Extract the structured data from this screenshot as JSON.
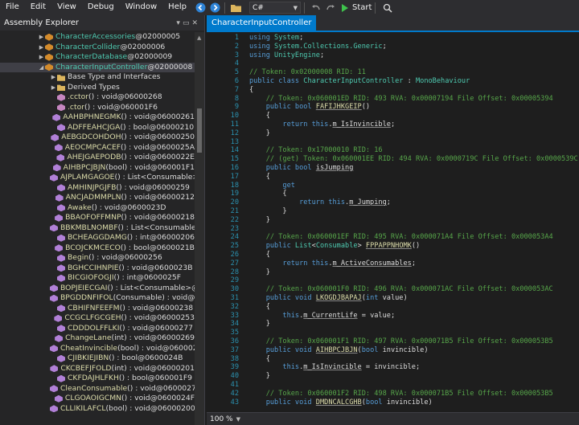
{
  "menu": {
    "items": [
      "File",
      "Edit",
      "View",
      "Debug",
      "Window",
      "Help"
    ],
    "language": "C#",
    "start_label": "Start"
  },
  "explorer": {
    "title": "Assembly Explorer",
    "rows": [
      {
        "expander": "▶",
        "icon": "class",
        "name": "CharacterAccessories",
        "nameKind": "class",
        "suffix": " @02000005",
        "indent": 1
      },
      {
        "expander": "▶",
        "icon": "class",
        "name": "CharacterCollider",
        "nameKind": "class",
        "suffix": " @02000006",
        "indent": 1
      },
      {
        "expander": "▶",
        "icon": "class",
        "name": "CharacterDatabase",
        "nameKind": "class",
        "suffix": " @02000009",
        "indent": 1
      },
      {
        "expander": "◢",
        "icon": "class",
        "name": "CharacterInputController",
        "nameKind": "class",
        "suffix": " @02000008",
        "indent": 1,
        "selected": true
      },
      {
        "expander": "▶",
        "icon": "folder",
        "name": "Base Type and Interfaces",
        "nameKind": "plain",
        "suffix": "",
        "indent": 2
      },
      {
        "expander": "▶",
        "icon": "folder",
        "name": "Derived Types",
        "nameKind": "plain",
        "suffix": "",
        "indent": 2
      },
      {
        "expander": "",
        "icon": "ctor",
        "name": ".cctor",
        "nameKind": "method",
        "sig": "() : void",
        "suffix": " @06000268",
        "indent": 2
      },
      {
        "expander": "",
        "icon": "ctor",
        "name": ".ctor",
        "nameKind": "method",
        "sig": "() : void",
        "suffix": " @060001F6",
        "indent": 2
      },
      {
        "expander": "",
        "icon": "method",
        "name": "AAHBPHNEGMK",
        "nameKind": "method",
        "sig": "() : void",
        "suffix": " @06000261",
        "indent": 2
      },
      {
        "expander": "",
        "icon": "method",
        "name": "ADFFEAHCJGA",
        "nameKind": "method",
        "sig": "() : bool",
        "suffix": " @06000210",
        "indent": 2
      },
      {
        "expander": "",
        "icon": "method",
        "name": "AEBGDCOHDOH",
        "nameKind": "method",
        "sig": "() : void",
        "suffix": " @06000250",
        "indent": 2
      },
      {
        "expander": "",
        "icon": "method",
        "name": "AEOCMPCACEF",
        "nameKind": "method",
        "sig": "() : void",
        "suffix": " @0600025A",
        "indent": 2
      },
      {
        "expander": "",
        "icon": "method",
        "name": "AHEJGAEPODB",
        "nameKind": "method",
        "sig": "() : void",
        "suffix": " @0600022E",
        "indent": 2
      },
      {
        "expander": "",
        "icon": "method",
        "name": "AIHBPCJBJN",
        "nameKind": "method",
        "sig": "(bool) : void",
        "suffix": " @060001F1",
        "indent": 2
      },
      {
        "expander": "",
        "icon": "method",
        "name": "AJPLAMGAGOE",
        "nameKind": "method",
        "sig": "() : List<Consumable>",
        "suffix": "",
        "indent": 2
      },
      {
        "expander": "",
        "icon": "method",
        "name": "AMHINJPGJFB",
        "nameKind": "method",
        "sig": "() : void",
        "suffix": " @06000259",
        "indent": 2
      },
      {
        "expander": "",
        "icon": "method",
        "name": "ANCJADMMPLN",
        "nameKind": "method",
        "sig": "() : void",
        "suffix": " @06000212",
        "indent": 2
      },
      {
        "expander": "",
        "icon": "method",
        "name": "Awake",
        "nameKind": "method",
        "sig": "() : void",
        "suffix": " @0600023D",
        "indent": 2
      },
      {
        "expander": "",
        "icon": "method",
        "name": "BBAOFOFFMNP",
        "nameKind": "method",
        "sig": "() : void",
        "suffix": " @06000218",
        "indent": 2
      },
      {
        "expander": "",
        "icon": "method",
        "name": "BBKMBLNOMBF",
        "nameKind": "method",
        "sig": "() : List<Consumable>",
        "suffix": "",
        "indent": 2
      },
      {
        "expander": "",
        "icon": "method",
        "name": "BCHEAGGDAMG",
        "nameKind": "method",
        "sig": "() : int",
        "suffix": " @06000206",
        "indent": 2
      },
      {
        "expander": "",
        "icon": "method",
        "name": "BCOJCKMCECO",
        "nameKind": "method",
        "sig": "() : bool",
        "suffix": " @0600021B",
        "indent": 2
      },
      {
        "expander": "",
        "icon": "method",
        "name": "Begin",
        "nameKind": "method",
        "sig": "() : void",
        "suffix": " @06000256",
        "indent": 2
      },
      {
        "expander": "",
        "icon": "method",
        "name": "BGHCCIHNPIE",
        "nameKind": "method",
        "sig": "() : void",
        "suffix": " @0600023B",
        "indent": 2
      },
      {
        "expander": "",
        "icon": "method",
        "name": "BICGIOFOGJI",
        "nameKind": "method",
        "sig": "() : int",
        "suffix": " @0600025F",
        "indent": 2
      },
      {
        "expander": "",
        "icon": "method",
        "name": "BOPJEIECGAI",
        "nameKind": "method",
        "sig": "() : List<Consumable>",
        "suffix": " @",
        "indent": 2
      },
      {
        "expander": "",
        "icon": "method",
        "name": "BPGDDNFIFOL",
        "nameKind": "method",
        "sig": "(Consumable) : void",
        "suffix": " @0600",
        "indent": 2
      },
      {
        "expander": "",
        "icon": "method",
        "name": "CBHIFNFEEFM",
        "nameKind": "method",
        "sig": "() : void",
        "suffix": " @06000238",
        "indent": 2
      },
      {
        "expander": "",
        "icon": "method",
        "name": "CCGCLFGCGEH",
        "nameKind": "method",
        "sig": "() : void",
        "suffix": " @06000253",
        "indent": 2
      },
      {
        "expander": "",
        "icon": "method",
        "name": "CDDDOLFFLKI",
        "nameKind": "method",
        "sig": "() : void",
        "suffix": " @06000277",
        "indent": 2
      },
      {
        "expander": "",
        "icon": "method",
        "name": "ChangeLane",
        "nameKind": "method",
        "sig": "(int) : void",
        "suffix": " @06000269",
        "indent": 2
      },
      {
        "expander": "",
        "icon": "method",
        "name": "CheatInvincible",
        "nameKind": "method",
        "sig": "(bool) : void",
        "suffix": " @060002",
        "indent": 2
      },
      {
        "expander": "",
        "icon": "method",
        "name": "CJIBKIEJIBN",
        "nameKind": "method",
        "sig": "() : bool",
        "suffix": " @0600024B",
        "indent": 2
      },
      {
        "expander": "",
        "icon": "method",
        "name": "CKCBEFJFOLD",
        "nameKind": "method",
        "sig": "(int) : void",
        "suffix": " @06000201",
        "indent": 2
      },
      {
        "expander": "",
        "icon": "method",
        "name": "CKFDAJHLFKH",
        "nameKind": "method",
        "sig": "() : bool",
        "suffix": " @060001F9",
        "indent": 2
      },
      {
        "expander": "",
        "icon": "method",
        "name": "CleanConsumable",
        "nameKind": "method",
        "sig": "() : void",
        "suffix": " @06000279",
        "indent": 2
      },
      {
        "expander": "",
        "icon": "method",
        "name": "CLGOAOIGCMN",
        "nameKind": "method",
        "sig": "() : void",
        "suffix": " @0600024F",
        "indent": 2
      },
      {
        "expander": "",
        "icon": "method",
        "name": "CLLIKILAFCL",
        "nameKind": "method",
        "sig": "(bool) : void",
        "suffix": " @06000200",
        "indent": 2
      }
    ]
  },
  "editor": {
    "tab_label": "CharacterInputController",
    "zoom": "100 %",
    "lines": [
      {
        "n": "1",
        "fold": "",
        "parts": [
          [
            "kw",
            "using "
          ],
          [
            "type",
            "System"
          ],
          [
            "txt",
            ";"
          ]
        ]
      },
      {
        "n": "2",
        "fold": "",
        "parts": [
          [
            "kw",
            "using "
          ],
          [
            "type",
            "System.Collections.Generic"
          ],
          [
            "txt",
            ";"
          ]
        ]
      },
      {
        "n": "3",
        "fold": "",
        "parts": [
          [
            "kw",
            "using "
          ],
          [
            "type",
            "UnityEngine"
          ],
          [
            "txt",
            ";"
          ]
        ]
      },
      {
        "n": "4",
        "fold": "",
        "parts": []
      },
      {
        "n": "5",
        "fold": "",
        "parts": [
          [
            "cmt",
            "// Token: 0x02000008 RID: 11"
          ]
        ]
      },
      {
        "n": "6",
        "fold": "",
        "parts": [
          [
            "kw",
            "public class "
          ],
          [
            "type",
            "CharacterInputController"
          ],
          [
            "txt",
            " : "
          ],
          [
            "type",
            "MonoBehaviour"
          ]
        ]
      },
      {
        "n": "7",
        "fold": "",
        "parts": [
          [
            "txt",
            "{"
          ]
        ]
      },
      {
        "n": "8",
        "fold": "",
        "parts": [
          [
            "cmt",
            "    // Token: 0x060001ED RID: 493 RVA: 0x00007194 File Offset: 0x00005394"
          ]
        ]
      },
      {
        "n": "9",
        "fold": "",
        "parts": [
          [
            "kw",
            "    public bool "
          ],
          [
            "mth",
            "FAFIJHKGEIP"
          ],
          [
            "txt",
            "()"
          ]
        ]
      },
      {
        "n": "10",
        "fold": "",
        "parts": [
          [
            "txt",
            "    {"
          ]
        ]
      },
      {
        "n": "11",
        "fold": "",
        "parts": [
          [
            "kw",
            "        return this"
          ],
          [
            "txt",
            "."
          ],
          [
            "fld",
            "m_IsInvincible"
          ],
          [
            "txt",
            ";"
          ]
        ]
      },
      {
        "n": "12",
        "fold": "",
        "parts": [
          [
            "txt",
            "    }"
          ]
        ]
      },
      {
        "n": "13",
        "fold": "",
        "parts": []
      },
      {
        "n": "14",
        "fold": "",
        "parts": [
          [
            "cmt",
            "    // Token: 0x17000010 RID: 16"
          ]
        ]
      },
      {
        "n": "15",
        "fold": "",
        "parts": [
          [
            "cmt",
            "    // (get) Token: 0x060001EE RID: 494 RVA: 0x0000719C File Offset: 0x0000539C"
          ]
        ]
      },
      {
        "n": "16",
        "fold": "",
        "parts": [
          [
            "kw",
            "    public bool "
          ],
          [
            "fld",
            "isJumping"
          ]
        ]
      },
      {
        "n": "17",
        "fold": "",
        "parts": [
          [
            "txt",
            "    {"
          ]
        ]
      },
      {
        "n": "18",
        "fold": "",
        "parts": [
          [
            "kw",
            "        get"
          ]
        ]
      },
      {
        "n": "19",
        "fold": "",
        "parts": [
          [
            "txt",
            "        {"
          ]
        ]
      },
      {
        "n": "20",
        "fold": "",
        "parts": [
          [
            "kw",
            "            return this"
          ],
          [
            "txt",
            "."
          ],
          [
            "fld",
            "m_Jumping"
          ],
          [
            "txt",
            ";"
          ]
        ]
      },
      {
        "n": "21",
        "fold": "",
        "parts": [
          [
            "txt",
            "        }"
          ]
        ]
      },
      {
        "n": "22",
        "fold": "",
        "parts": [
          [
            "txt",
            "    }"
          ]
        ]
      },
      {
        "n": "23",
        "fold": "",
        "parts": []
      },
      {
        "n": "24",
        "fold": "",
        "parts": [
          [
            "cmt",
            "    // Token: 0x060001EF RID: 495 RVA: 0x000071A4 File Offset: 0x000053A4"
          ]
        ]
      },
      {
        "n": "25",
        "fold": "",
        "parts": [
          [
            "kw",
            "    public "
          ],
          [
            "type",
            "List"
          ],
          [
            "txt",
            "<"
          ],
          [
            "type",
            "Consumable"
          ],
          [
            "txt",
            "> "
          ],
          [
            "mth",
            "FPPAPPNHOMK"
          ],
          [
            "txt",
            "()"
          ]
        ]
      },
      {
        "n": "26",
        "fold": "",
        "parts": [
          [
            "txt",
            "    {"
          ]
        ]
      },
      {
        "n": "27",
        "fold": "",
        "parts": [
          [
            "kw",
            "        return this"
          ],
          [
            "txt",
            "."
          ],
          [
            "fld",
            "m_ActiveConsumables"
          ],
          [
            "txt",
            ";"
          ]
        ]
      },
      {
        "n": "28",
        "fold": "",
        "parts": [
          [
            "txt",
            "    }"
          ]
        ]
      },
      {
        "n": "29",
        "fold": "",
        "parts": []
      },
      {
        "n": "30",
        "fold": "",
        "parts": [
          [
            "cmt",
            "    // Token: 0x060001F0 RID: 496 RVA: 0x000071AC File Offset: 0x000053AC"
          ]
        ]
      },
      {
        "n": "31",
        "fold": "",
        "parts": [
          [
            "kw",
            "    public void "
          ],
          [
            "mth",
            "LKOGDJBAPAJ"
          ],
          [
            "txt",
            "("
          ],
          [
            "kw",
            "int "
          ],
          [
            "txt",
            "value)"
          ]
        ]
      },
      {
        "n": "32",
        "fold": "",
        "parts": [
          [
            "txt",
            "    {"
          ]
        ]
      },
      {
        "n": "33",
        "fold": "",
        "parts": [
          [
            "kw",
            "        this"
          ],
          [
            "txt",
            "."
          ],
          [
            "fld",
            "m_CurrentLife"
          ],
          [
            "txt",
            " = value;"
          ]
        ]
      },
      {
        "n": "34",
        "fold": "",
        "parts": [
          [
            "txt",
            "    }"
          ]
        ]
      },
      {
        "n": "35",
        "fold": "",
        "parts": []
      },
      {
        "n": "36",
        "fold": "",
        "parts": [
          [
            "cmt",
            "    // Token: 0x060001F1 RID: 497 RVA: 0x000071B5 File Offset: 0x000053B5"
          ]
        ]
      },
      {
        "n": "37",
        "fold": "",
        "parts": [
          [
            "kw",
            "    public void "
          ],
          [
            "mth",
            "AIHBPCJBJN"
          ],
          [
            "txt",
            "("
          ],
          [
            "kw",
            "bool "
          ],
          [
            "txt",
            "invincible)"
          ]
        ]
      },
      {
        "n": "38",
        "fold": "",
        "parts": [
          [
            "txt",
            "    {"
          ]
        ]
      },
      {
        "n": "39",
        "fold": "",
        "parts": [
          [
            "kw",
            "        this"
          ],
          [
            "txt",
            "."
          ],
          [
            "fld",
            "m_IsInvincible"
          ],
          [
            "txt",
            " = invincible;"
          ]
        ]
      },
      {
        "n": "40",
        "fold": "",
        "parts": [
          [
            "txt",
            "    }"
          ]
        ]
      },
      {
        "n": "41",
        "fold": "",
        "parts": []
      },
      {
        "n": "42",
        "fold": "",
        "parts": [
          [
            "cmt",
            "    // Token: 0x060001F2 RID: 498 RVA: 0x000071B5 File Offset: 0x000053B5"
          ]
        ]
      },
      {
        "n": "43",
        "fold": "",
        "parts": [
          [
            "kw",
            "    public void "
          ],
          [
            "mth",
            "DMDNCALCGHB"
          ],
          [
            "txt",
            "("
          ],
          [
            "kw",
            "bool "
          ],
          [
            "txt",
            "invincible)"
          ]
        ]
      }
    ]
  }
}
